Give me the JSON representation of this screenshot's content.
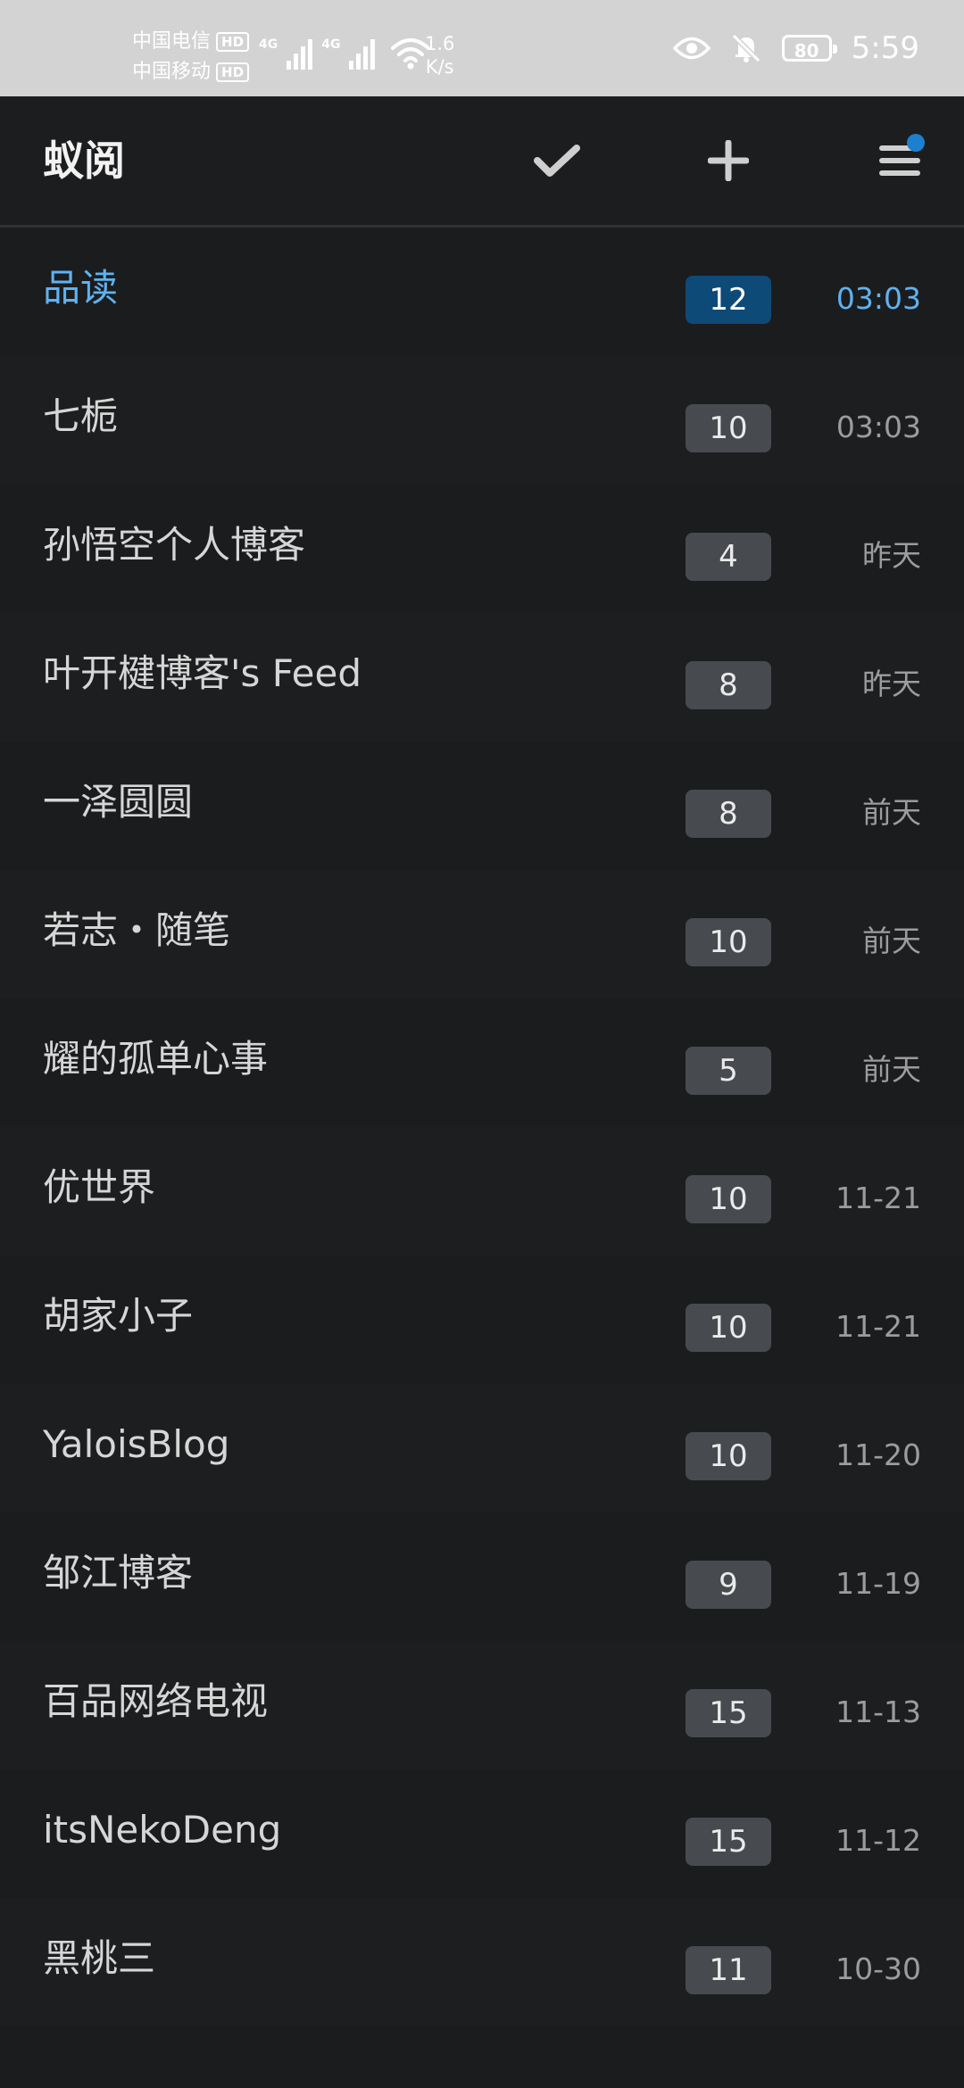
{
  "status_bar": {
    "carrier_1": "中国电信",
    "carrier_2": "中国移动",
    "hd_label": "HD",
    "net_type": "4G",
    "speed_value": "1.6",
    "speed_unit": "K/s",
    "battery": "80",
    "time": "5:59"
  },
  "app_bar": {
    "title": "蚁阅",
    "icons": [
      "check-icon",
      "plus-icon",
      "menu-icon"
    ],
    "badge_color": "#1e7fcf"
  },
  "colors": {
    "accent": "#5fb2ef",
    "active_badge": "#0e4a78",
    "badge": "#474a4e",
    "background": "#1b1c1e"
  },
  "feeds": [
    {
      "name": "品读",
      "count": "12",
      "time": "03:03",
      "active": true
    },
    {
      "name": "七栀",
      "count": "10",
      "time": "03:03"
    },
    {
      "name": "孙悟空个人博客",
      "count": "4",
      "time": "昨天"
    },
    {
      "name": "叶开楗博客's Feed",
      "count": "8",
      "time": "昨天"
    },
    {
      "name": "一泽圆圆",
      "count": "8",
      "time": "前天"
    },
    {
      "name": "若志・随笔",
      "count": "10",
      "time": "前天"
    },
    {
      "name": "耀的孤单心事",
      "count": "5",
      "time": "前天"
    },
    {
      "name": "优世界",
      "count": "10",
      "time": "11-21"
    },
    {
      "name": "胡家小子",
      "count": "10",
      "time": "11-21"
    },
    {
      "name": "YaloisBlog",
      "count": "10",
      "time": "11-20"
    },
    {
      "name": "邹江博客",
      "count": "9",
      "time": "11-19"
    },
    {
      "name": "百品网络电视",
      "count": "15",
      "time": "11-13"
    },
    {
      "name": "itsNekoDeng",
      "count": "15",
      "time": "11-12"
    },
    {
      "name": "黑桃三",
      "count": "11",
      "time": "10-30"
    }
  ]
}
